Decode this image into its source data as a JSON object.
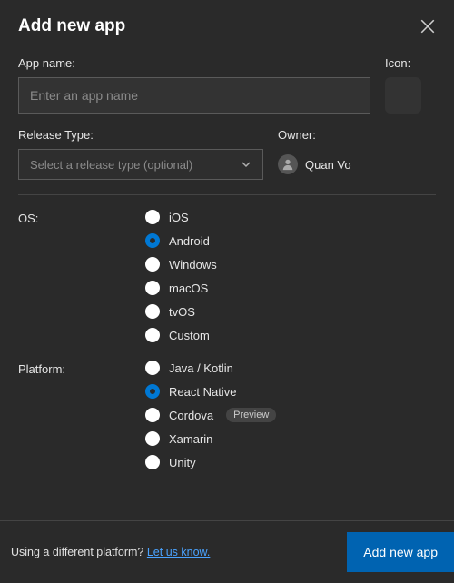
{
  "header": {
    "title": "Add new app"
  },
  "appName": {
    "label": "App name:",
    "placeholder": "Enter an app name",
    "value": ""
  },
  "icon": {
    "label": "Icon:"
  },
  "releaseType": {
    "label": "Release Type:",
    "placeholder": "Select a release type (optional)"
  },
  "owner": {
    "label": "Owner:",
    "name": "Quan Vo"
  },
  "os": {
    "label": "OS:",
    "options": [
      "iOS",
      "Android",
      "Windows",
      "macOS",
      "tvOS",
      "Custom"
    ],
    "selected": "Android"
  },
  "platform": {
    "label": "Platform:",
    "options": [
      {
        "name": "Java / Kotlin",
        "preview": false
      },
      {
        "name": "React Native",
        "preview": false
      },
      {
        "name": "Cordova",
        "preview": true
      },
      {
        "name": "Xamarin",
        "preview": false
      },
      {
        "name": "Unity",
        "preview": false
      }
    ],
    "selected": "React Native",
    "previewBadge": "Preview"
  },
  "footer": {
    "text": "Using a different platform? ",
    "linkText": "Let us know.",
    "button": "Add new app"
  }
}
